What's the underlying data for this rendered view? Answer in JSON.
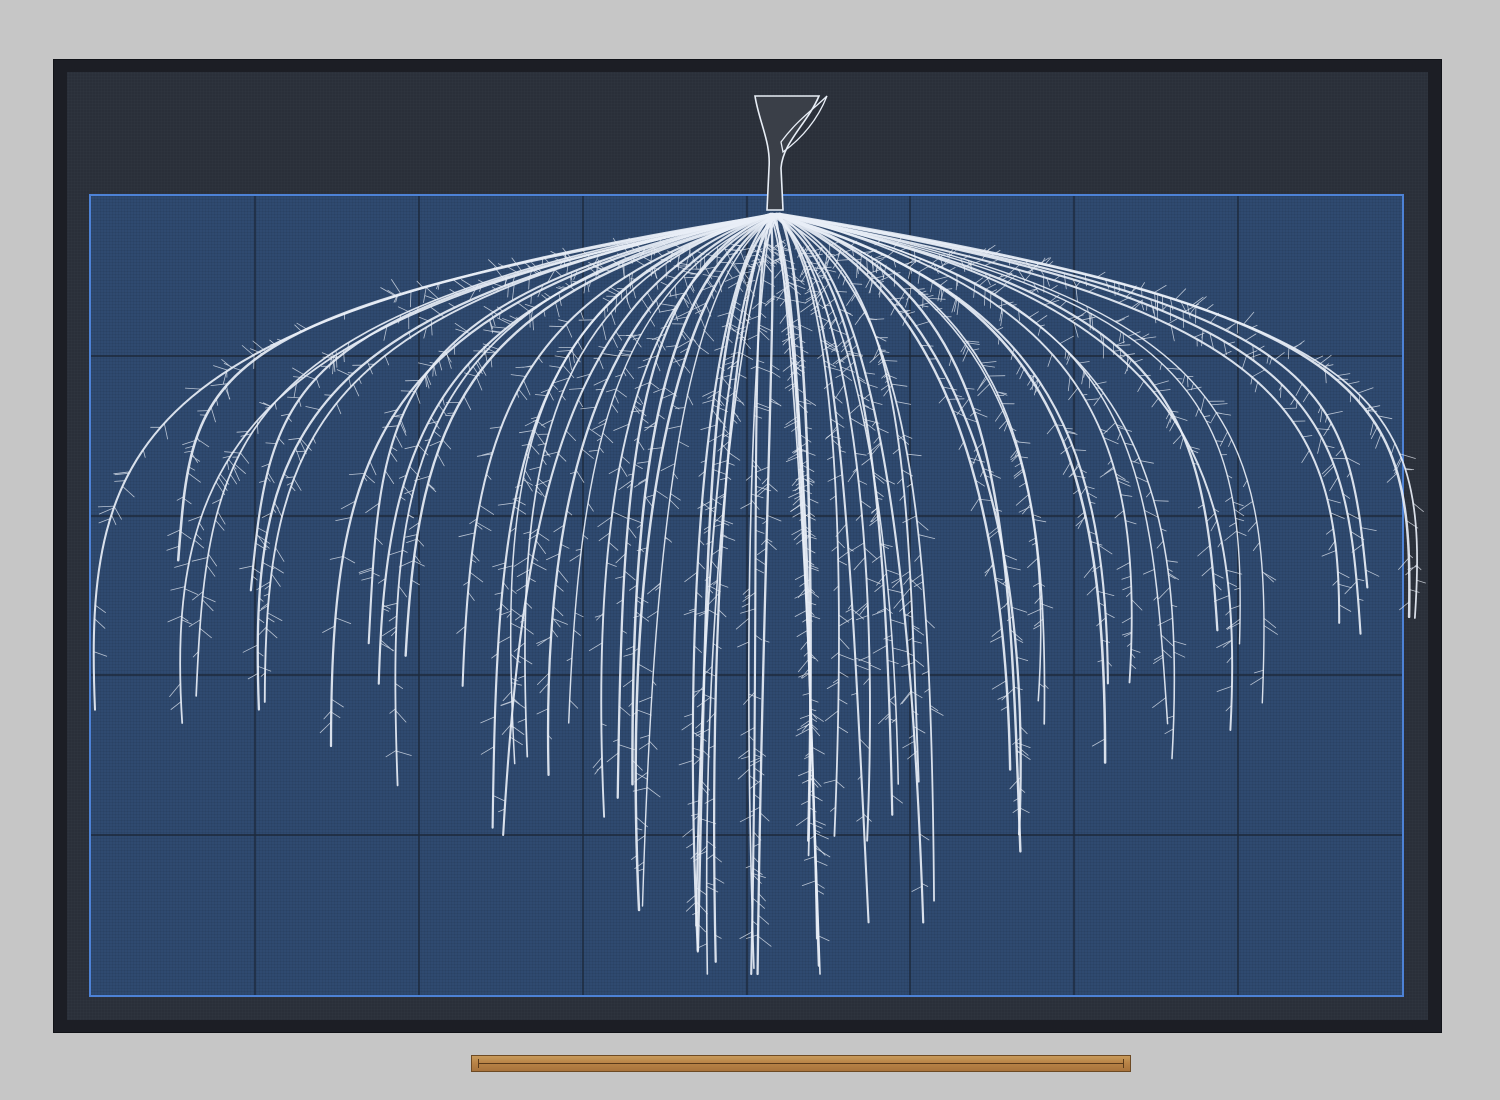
{
  "artwork": {
    "subject": "",
    "colors": {
      "wall": "#c6c6c6",
      "frame": "#1c1e25",
      "mat": "#2a2f39",
      "soil_panel": "#2f4a70",
      "panel_border": "#4d82d6",
      "grid_lines": "#1a2433",
      "roots": "#e8eef6",
      "ruler": "#b98447"
    },
    "icons": {
      "stem": "plant-stem-icon",
      "roots": "root-system-icon",
      "ruler": "measuring-stick-icon"
    }
  }
}
